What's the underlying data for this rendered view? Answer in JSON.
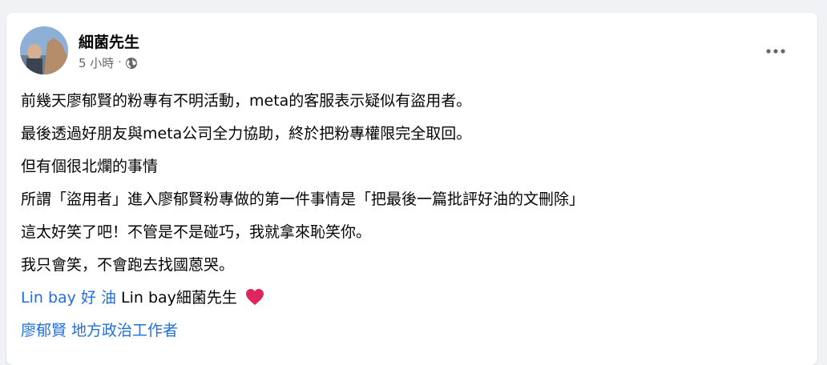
{
  "post": {
    "author": "細菌先生",
    "time": "5 小時",
    "separator": "·",
    "privacy_icon": "globe-icon",
    "more_icon": "more-options-icon",
    "lines": [
      "前幾天廖郁賢的粉專有不明活動，meta的客服表示疑似有盜用者。",
      "最後透過好朋友與meta公司全力協助，終於把粉專權限完全取回。",
      "但有個很北爛的事情",
      "所謂「盜用者」進入廖郁賢粉專做的第一件事情是「把最後一篇批評好油的文刪除」",
      "這太好笑了吧！不管是不是碰巧，我就拿來恥笑你。",
      "我只會笑，不會跑去找國蒽哭。"
    ],
    "tag_line": {
      "link": "Lin bay 好 油",
      "text": " Lin bay細菌先生 ",
      "emoji_icon": "red-heart-icon"
    },
    "mention_line": {
      "link": "廖郁賢 地方政治工作者"
    }
  },
  "colors": {
    "link": "#216fdb",
    "text": "#050505",
    "secondary": "#65676b",
    "heart": "#e0245e"
  }
}
